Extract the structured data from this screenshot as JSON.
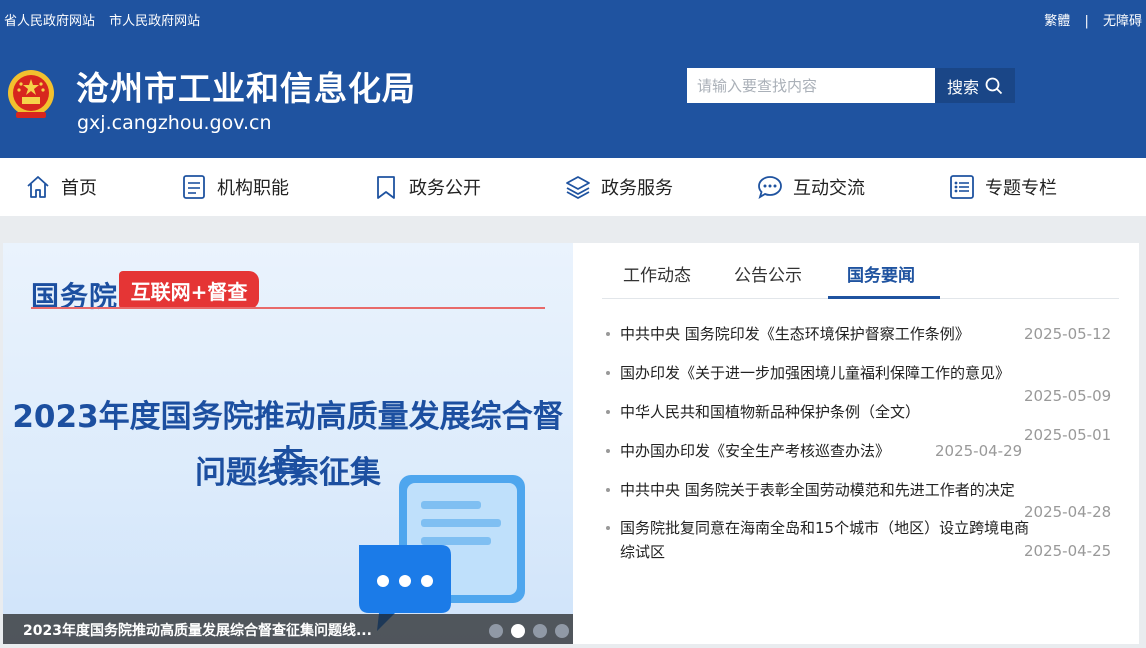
{
  "toplinks": {
    "left": [
      "省人民政府网站",
      "市人民政府网站"
    ],
    "traditional": "繁體",
    "separator": "|",
    "accessibility": "无障碍"
  },
  "header": {
    "title": "沧州市工业和信息化局",
    "domain": "gxj.cangzhou.gov.cn",
    "search_placeholder": "请输入要查找内容",
    "search_label": "搜索"
  },
  "colors": {
    "brand": "#1f53a0",
    "accent_red": "#e53535"
  },
  "nav": [
    {
      "label": "首页",
      "icon": "home-icon"
    },
    {
      "label": "机构职能",
      "icon": "document-icon"
    },
    {
      "label": "政务公开",
      "icon": "bookmark-icon"
    },
    {
      "label": "政务服务",
      "icon": "layers-icon"
    },
    {
      "label": "互动交流",
      "icon": "chat-icon"
    },
    {
      "label": "专题专栏",
      "icon": "list-icon"
    }
  ],
  "banner": {
    "brand": "国务院",
    "tag": "互联网+督查",
    "headline1": "2023年度国务院推动高质量发展综合督查",
    "headline2": "问题线索征集",
    "caption": "2023年度国务院推动高质量发展综合督查征集问题线...",
    "slides": 4,
    "active_slide": 2
  },
  "news": {
    "tabs": [
      "工作动态",
      "公告公示",
      "国务要闻"
    ],
    "active_tab": "国务要闻",
    "items": [
      {
        "title": "中共中央 国务院印发《生态环境保护督察工作条例》",
        "date": "2025-05-12"
      },
      {
        "title": "国办印发《关于进一步加强困境儿童福利保障工作的意见》",
        "date": "2025-05-09"
      },
      {
        "title": "中华人民共和国植物新品种保护条例（全文）",
        "date": "2025-05-01"
      },
      {
        "title": "中办国办印发《安全生产考核巡查办法》",
        "date": "2025-04-29"
      },
      {
        "title": "中共中央 国务院关于表彰全国劳动模范和先进工作者的决定",
        "date": "2025-04-28"
      },
      {
        "title": "国务院批复同意在海南全岛和15个城市（地区）设立跨境电商综试区",
        "date": "2025-04-25"
      }
    ]
  }
}
